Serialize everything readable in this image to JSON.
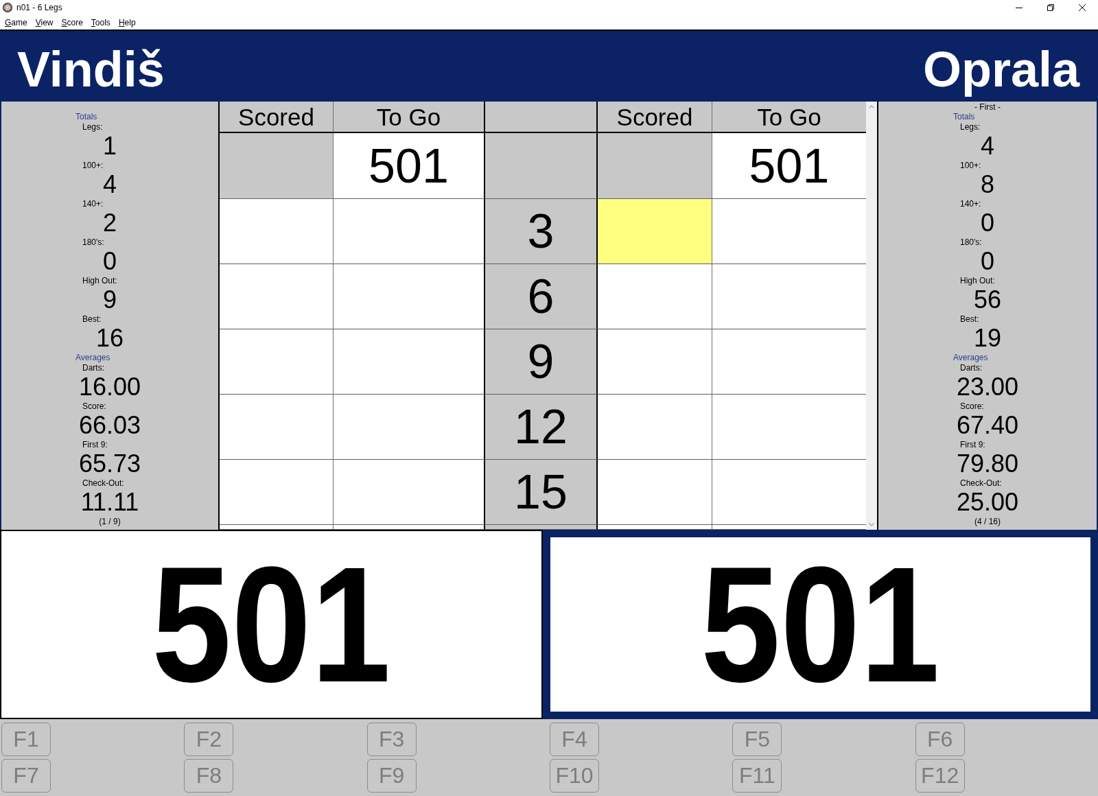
{
  "window": {
    "title": "n01 - 6 Legs"
  },
  "menu": [
    "Game",
    "View",
    "Score",
    "Tools",
    "Help"
  ],
  "players": [
    {
      "name": "Vindiš",
      "active": false,
      "stats": [
        {
          "kind": "heading",
          "text": "Totals"
        },
        {
          "kind": "stat",
          "label": "Legs:",
          "value": "1"
        },
        {
          "kind": "stat",
          "label": "100+:",
          "value": "4"
        },
        {
          "kind": "stat",
          "label": "140+:",
          "value": "2"
        },
        {
          "kind": "stat",
          "label": "180's:",
          "value": "0"
        },
        {
          "kind": "stat",
          "label": "High Out:",
          "value": "9"
        },
        {
          "kind": "stat",
          "label": "Best:",
          "value": "16"
        },
        {
          "kind": "heading",
          "text": "Averages"
        },
        {
          "kind": "stat",
          "label": "Darts:",
          "value": "16.00"
        },
        {
          "kind": "stat",
          "label": "Score:",
          "value": "66.03"
        },
        {
          "kind": "stat",
          "label": "First 9:",
          "value": "65.73"
        },
        {
          "kind": "stat",
          "label": "Check-Out:",
          "value": "11.11"
        },
        {
          "kind": "note",
          "text": "(1 / 9)"
        }
      ],
      "columns": [
        "Scored",
        "To Go"
      ],
      "start_to_go": "501",
      "remaining": "501"
    },
    {
      "name": "Oprala",
      "active": true,
      "marker": "- First -",
      "stats": [
        {
          "kind": "heading",
          "text": "Totals"
        },
        {
          "kind": "stat",
          "label": "Legs:",
          "value": "4"
        },
        {
          "kind": "stat",
          "label": "100+:",
          "value": "8"
        },
        {
          "kind": "stat",
          "label": "140+:",
          "value": "0"
        },
        {
          "kind": "stat",
          "label": "180's:",
          "value": "0"
        },
        {
          "kind": "stat",
          "label": "High Out:",
          "value": "56"
        },
        {
          "kind": "stat",
          "label": "Best:",
          "value": "19"
        },
        {
          "kind": "heading",
          "text": "Averages"
        },
        {
          "kind": "stat",
          "label": "Darts:",
          "value": "23.00"
        },
        {
          "kind": "stat",
          "label": "Score:",
          "value": "67.40"
        },
        {
          "kind": "stat",
          "label": "First 9:",
          "value": "79.80"
        },
        {
          "kind": "stat",
          "label": "Check-Out:",
          "value": "25.00"
        },
        {
          "kind": "note",
          "text": "(4 / 16)"
        }
      ],
      "columns": [
        "Scored",
        "To Go"
      ],
      "start_to_go": "501",
      "remaining": "501"
    }
  ],
  "turns": [
    {
      "darts": "3",
      "players": [
        {
          "input": false
        },
        {
          "input": true
        }
      ]
    },
    {
      "darts": "6",
      "players": [
        {
          "input": false
        },
        {
          "input": false
        }
      ]
    },
    {
      "darts": "9",
      "players": [
        {
          "input": false
        },
        {
          "input": false
        }
      ]
    },
    {
      "darts": "12",
      "players": [
        {
          "input": false
        },
        {
          "input": false
        }
      ]
    },
    {
      "darts": "15",
      "players": [
        {
          "input": false
        },
        {
          "input": false
        }
      ]
    }
  ],
  "function_keys": [
    {
      "label": "F1",
      "disabled": true
    },
    {
      "label": "F2",
      "disabled": true
    },
    {
      "label": "F3",
      "disabled": true
    },
    {
      "label": "F4",
      "disabled": true
    },
    {
      "label": "F5",
      "disabled": true
    },
    {
      "label": "F6",
      "disabled": true
    },
    {
      "label": "F7",
      "disabled": true
    },
    {
      "label": "F8",
      "disabled": true
    },
    {
      "label": "F9",
      "disabled": true
    },
    {
      "label": "F10",
      "disabled": true
    },
    {
      "label": "F11",
      "disabled": true
    },
    {
      "label": "F12",
      "disabled": true
    }
  ]
}
